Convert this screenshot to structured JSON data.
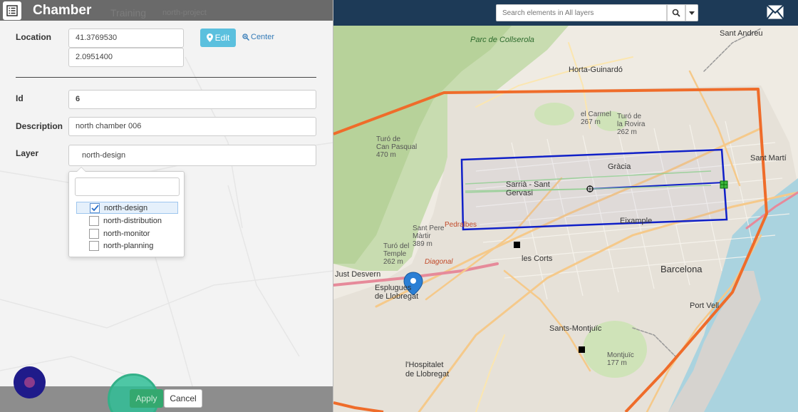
{
  "header": {
    "app_icon": "list-icon",
    "title": "Chamber",
    "tabs": [
      "Training",
      "north-project"
    ]
  },
  "form": {
    "location_label": "Location",
    "latitude": "41.3769530",
    "longitude": "2.0951400",
    "edit_label": "Edit",
    "center_label": "Center",
    "id_label": "Id",
    "id_value": "6",
    "description_label": "Description",
    "description_value": "north chamber 006",
    "layer_label": "Layer",
    "layer_value": "north-design"
  },
  "layer_dropdown": {
    "items": [
      {
        "label": "north-design",
        "checked": true
      },
      {
        "label": "north-distribution",
        "checked": false
      },
      {
        "label": "north-monitor",
        "checked": false
      },
      {
        "label": "north-planning",
        "checked": false
      }
    ]
  },
  "footer": {
    "apply_label": "Apply",
    "cancel_label": "Cancel"
  },
  "topbar": {
    "search_placeholder": "Search elements in All layers",
    "search_icon": "search-icon",
    "caret_icon": "caret-down-icon",
    "mail_icon": "mail-icon"
  },
  "map": {
    "labels": {
      "parc_collserola": "Parc de\nCollserola",
      "horta": "Horta-Guinardó",
      "sant_andreu": "Sant Andreu",
      "gracia": "Gràcia",
      "sarria": "Sarrià - Sant\nGervasi",
      "eixample": "Eixample",
      "les_corts": "les Corts",
      "barcelona": "Barcelona",
      "just_desvern": "Just Desvern",
      "esplugues": "Esplugues\nde Llobregat",
      "sants": "Sants-Montjuïc",
      "hospitalet": "l'Hospitalet\nde Llobregat",
      "sant_marti": "Sant Martí",
      "port_vell": "Port Vell",
      "montjuic": "Montjuïc\n177 m",
      "pedralbes": "Pedralbes",
      "sant_pere_martir": "Sant Pere\nMàrtir\n389 m",
      "turo_de_can_pasqual": "Turó de\nCan Pasqual\n470 m",
      "turo_del_temple": "Turó del\nTemple\n262 m",
      "diagonal": "Diagonal",
      "el_carmel": "el Carmel\n267 m",
      "la_rovira": "Turó de\nla Rovira\n262 m"
    },
    "colors": {
      "boundary": "#ef6c2a",
      "selection": "#1020c8",
      "marker": "#2b7fd4"
    }
  }
}
